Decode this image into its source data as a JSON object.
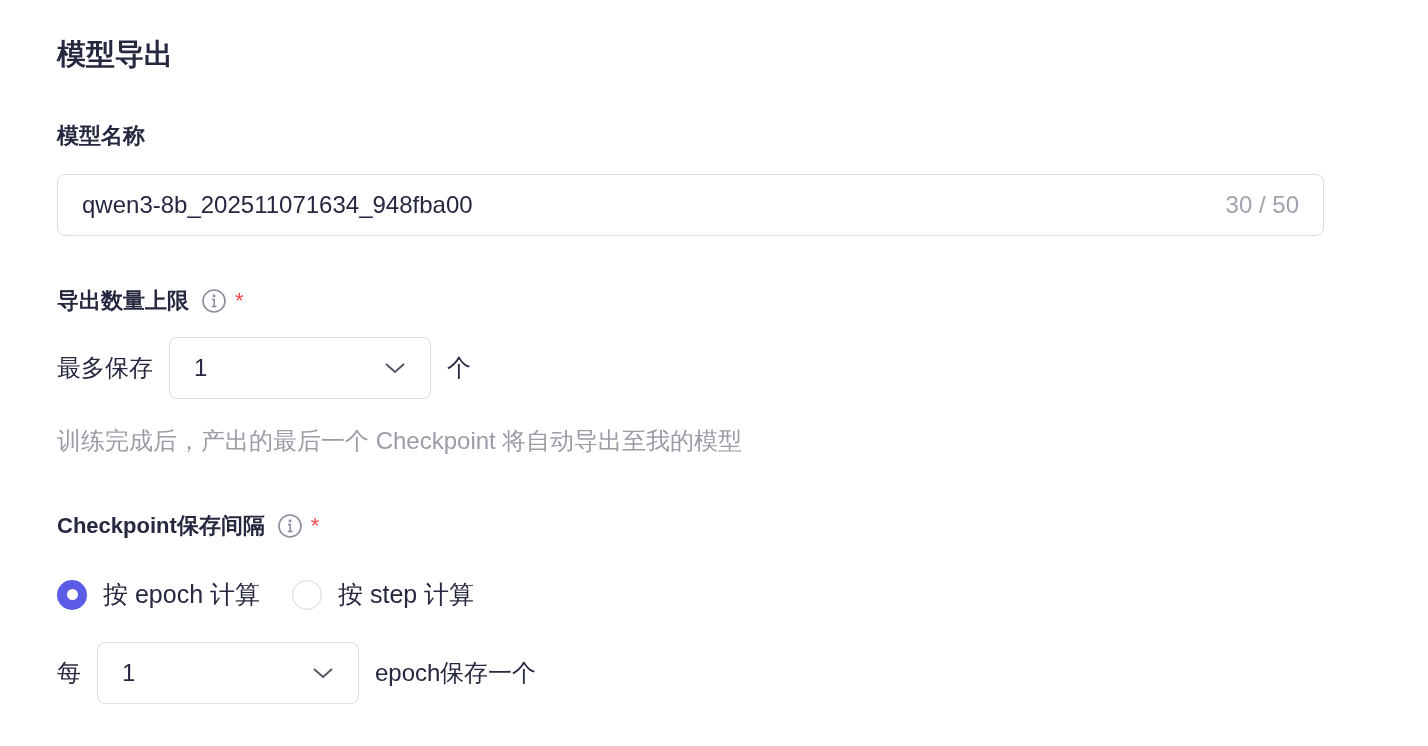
{
  "title": "模型导出",
  "model_name": {
    "label": "模型名称",
    "value": "qwen3-8b_202511071634_948fba00",
    "counter": "30 / 50"
  },
  "export_limit": {
    "label": "导出数量上限",
    "required_mark": "*",
    "prefix": "最多保存",
    "select_value": "1",
    "suffix": "个",
    "hint": "训练完成后，产出的最后一个 Checkpoint 将自动导出至我的模型"
  },
  "checkpoint_interval": {
    "label": "Checkpoint保存间隔",
    "required_mark": "*",
    "options": [
      {
        "label": "按 epoch 计算",
        "selected": true
      },
      {
        "label": "按 step 计算",
        "selected": false
      }
    ],
    "prefix": "每",
    "select_value": "1",
    "suffix": "epoch保存一个"
  }
}
